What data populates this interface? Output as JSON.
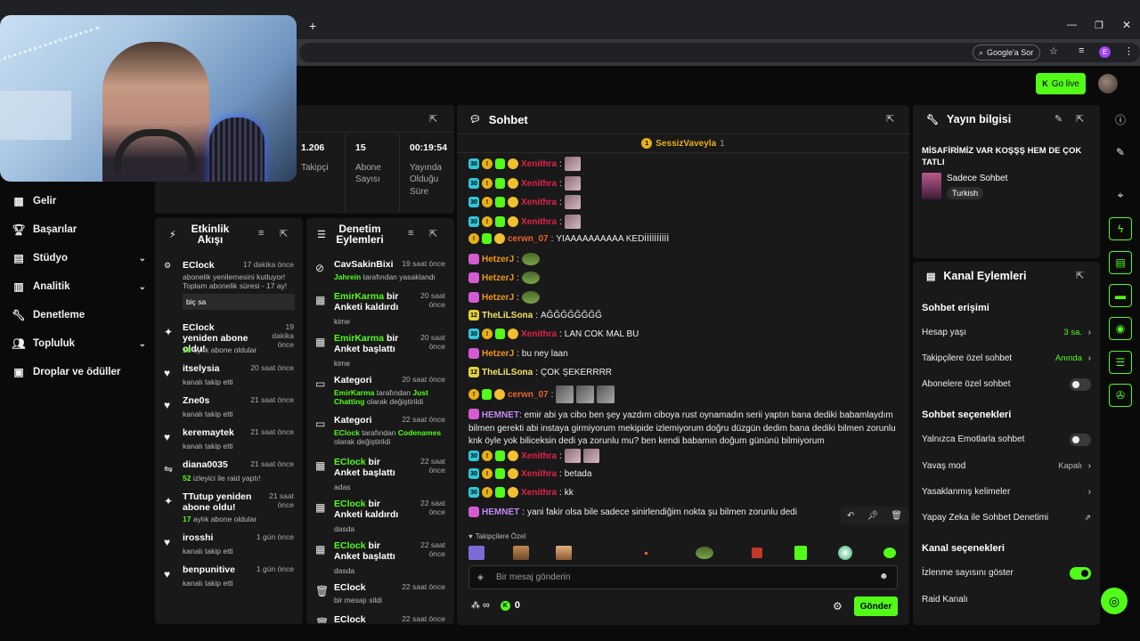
{
  "browser": {
    "new_tab": "+",
    "google_search": "Google'a Sor"
  },
  "topbar": {
    "go_live": "Go live"
  },
  "nav": {
    "items": [
      {
        "label": "Gelir",
        "icon": "table-icon"
      },
      {
        "label": "Başarılar",
        "icon": "trophy-icon"
      },
      {
        "label": "Stüdyo",
        "icon": "studio-icon"
      },
      {
        "label": "Analitik",
        "icon": "chart-icon"
      },
      {
        "label": "Denetleme",
        "icon": "wrench-icon"
      },
      {
        "label": "Topluluk",
        "icon": "community-icon"
      },
      {
        "label": "Droplar ve ödüller",
        "icon": "gift-icon"
      }
    ]
  },
  "stats": [
    {
      "value": "1.206",
      "label": "Takipçi"
    },
    {
      "value": "15",
      "label": "Abone Sayısı"
    },
    {
      "value": "00:19:54",
      "label": "Yayında Olduğu Süre"
    }
  ],
  "activity": {
    "title": "Etkinlik Akışı",
    "items": [
      {
        "name": "EClock",
        "time": "17 dakika önce",
        "line1": "abonelik yenilemesini kutluyor!",
        "line2": "Toplam abonelik süresi - 17 ay!",
        "msg": "biç sa"
      },
      {
        "name": "EClock yeniden abone oldu!",
        "time": "19 dakika önce",
        "highlight": "18",
        "sub": "aylık abone oldular"
      },
      {
        "name": "itselysia",
        "time": "20 saat önce",
        "sub": "kanalı takip etti"
      },
      {
        "name": "Zne0s",
        "time": "21 saat önce",
        "sub": "kanalı takip etti"
      },
      {
        "name": "keremaytek",
        "time": "21 saat önce",
        "sub": "kanalı takip etti"
      },
      {
        "name": "diana0035",
        "time": "21 saat önce",
        "highlight": "52",
        "sub": "izleyici ile raid yaptı!"
      },
      {
        "name": "TTutup yeniden abone oldu!",
        "time": "21 saat önce",
        "highlight": "17",
        "sub": "aylık abone oldular"
      },
      {
        "name": "irosshi",
        "time": "1 gün önce",
        "sub": "kanalı takip etti"
      },
      {
        "name": "benpunitive",
        "time": "1 gün önce",
        "sub": "kanalı takip etti"
      }
    ]
  },
  "moderation": {
    "title": "Denetim Eylemleri",
    "items": [
      {
        "title": "CavSakinBixi",
        "time": "19 saat önce",
        "detail_hl": "Jahrein",
        "detail": "tarafından yasaklandı"
      },
      {
        "title_hl": "EmirKarma",
        "title": "bir Anketi kaldırdı",
        "time": "20 saat önce",
        "detail": "kime"
      },
      {
        "title_hl": "EmirKarma",
        "title": "bir Anket başlattı",
        "time": "20 saat önce",
        "detail": "kime"
      },
      {
        "title": "Kategori",
        "time": "20 saat önce",
        "detail_hl": "EmirKarma",
        "detail": "tarafından",
        "detail_hl2": "Just Chatting",
        "detail2": "olarak değiştirildi"
      },
      {
        "title": "Kategori",
        "time": "22 saat önce",
        "detail_hl": "EClock",
        "detail": "tarafından",
        "detail_hl2": "Codenames",
        "detail2": "olarak değiştirildi"
      },
      {
        "title_hl": "EClock",
        "title": "bir Anket başlattı",
        "time": "22 saat önce",
        "detail": "adas"
      },
      {
        "title_hl": "EClock",
        "title": "bir Anketi kaldırdı",
        "time": "22 saat önce",
        "detail": "dasda"
      },
      {
        "title_hl": "EClock",
        "title": "bir Anket başlattı",
        "time": "22 saat önce",
        "detail": "dasda"
      },
      {
        "title": "EClock",
        "time": "22 saat önce",
        "detail": "bir mesajı sildi"
      },
      {
        "title": "EClock",
        "time": "22 saat önce",
        "detail": ""
      }
    ]
  },
  "chat": {
    "title": "Sohbet",
    "pinned_user": "SessizVaveyla",
    "pinned_count": "1",
    "messages": [
      {
        "user": "Xenithra",
        "text": ""
      },
      {
        "user": "Xenithra",
        "text": ""
      },
      {
        "user": "Xenithra",
        "text": ""
      },
      {
        "user": "Xenithra",
        "text": ""
      },
      {
        "user": "cerwn_07",
        "text": "YIAAAAAAAAAA KEDİİİİİİİİİİ"
      },
      {
        "user": "HetzerJ",
        "text": ""
      },
      {
        "user": "HetzerJ",
        "text": ""
      },
      {
        "user": "HetzerJ",
        "text": ""
      },
      {
        "user": "TheLiLSona",
        "text": "AĞĞĞĞĞĞĞĞ"
      },
      {
        "user": "Xenithra",
        "text": "LAN COK MAL BU"
      },
      {
        "user": "HetzerJ",
        "text": "bu ney laan"
      },
      {
        "user": "TheLiLSona",
        "text": "ÇOK ŞEKERRRR"
      },
      {
        "user": "cerwn_07",
        "text": ""
      },
      {
        "user": "HEMNET",
        "text": "emir abi ya cibo ben şey yazdım ciboya rust oynamadın serii yaptın bana dediki babamlaydım bilmen gerekti abi instaya girmiyorum mekipide izlemiyorum doğru düzgün dedim bana dediki bilmen zorunlu knk öyle yok biliceksin dedi ya zorunlu mu? ben kendi babamın doğum gününü bilmiyorum"
      },
      {
        "user": "Xenithra",
        "text": ""
      },
      {
        "user": "Xenithra",
        "text": "betada"
      },
      {
        "user": "Xenithra",
        "text": "kk"
      },
      {
        "user": "HEMNET",
        "text": "yani fakir olsa bile sadece sinirlendiğim nokta şu bilmen zorunlu dedi"
      }
    ],
    "followers_only_label": "Takipçilere Özel",
    "input_placeholder": "Bir mesaj gönderin",
    "infinity": "∞",
    "points": "0",
    "send": "Gönder"
  },
  "stream_info": {
    "title": "Yayın bilgisi",
    "stream_title": "MİSAFİRİMİZ VAR KOŞŞŞ HEM DE ÇOK TATLI",
    "category": "Sadece Sohbet",
    "language": "Turkish"
  },
  "channel_actions": {
    "title": "Kanal Eylemleri",
    "chat_access": "Sohbet erişimi",
    "account_age": "Hesap yaşı",
    "account_age_val": "3 sa.",
    "followers_only": "Takipçilere özel sohbet",
    "followers_only_val": "Anında",
    "subs_only": "Abonelere özel sohbet",
    "chat_options": "Sohbet seçenekleri",
    "emote_only": "Yalnızca Emotlarla sohbet",
    "slow_mode": "Yavaş mod",
    "slow_mode_val": "Kapalı",
    "banned_words": "Yasaklanmış kelimeler",
    "ai_moderation": "Yapay Zeka ile Sohbet Denetimi",
    "channel_options": "Kanal seçenekleri",
    "show_viewers": "İzlenme sayısını göster",
    "raid": "Raid Kanalı"
  },
  "colors": {
    "accent": "#53fc18",
    "bg": "#0a0a0a",
    "panel": "#191919"
  }
}
